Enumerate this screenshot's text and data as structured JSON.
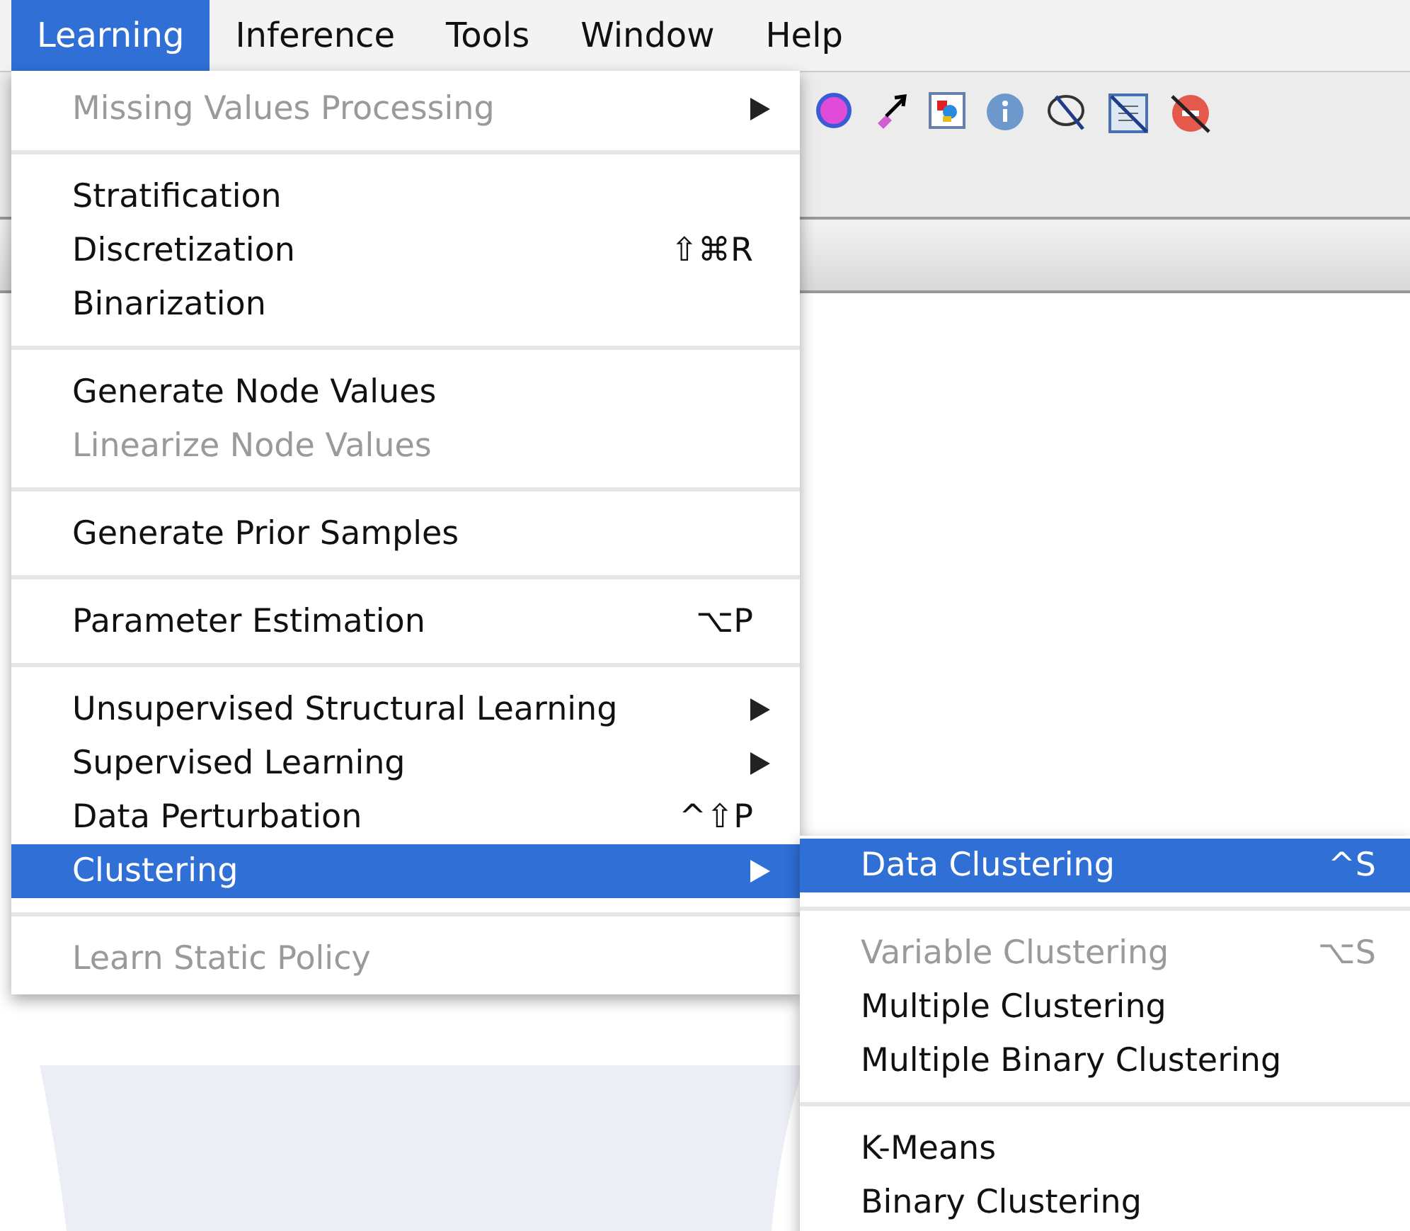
{
  "menubar": [
    {
      "label": "Learning",
      "selected": true
    },
    {
      "label": "Inference",
      "selected": false
    },
    {
      "label": "Tools",
      "selected": false
    },
    {
      "label": "Window",
      "selected": false
    },
    {
      "label": "Help",
      "selected": false
    }
  ],
  "menu": [
    [
      {
        "label": "Missing Values Processing",
        "submenu": true,
        "disabled": true,
        "selected": false
      }
    ],
    [
      {
        "label": "Stratification",
        "submenu": false,
        "disabled": false,
        "selected": false
      },
      {
        "label": "Discretization",
        "shortcut": "⇧⌘R",
        "submenu": false,
        "disabled": false,
        "selected": false
      },
      {
        "label": "Binarization",
        "submenu": false,
        "disabled": false,
        "selected": false
      }
    ],
    [
      {
        "label": "Generate Node Values",
        "submenu": false,
        "disabled": false,
        "selected": false
      },
      {
        "label": "Linearize Node Values",
        "submenu": false,
        "disabled": true,
        "selected": false
      }
    ],
    [
      {
        "label": "Generate Prior Samples",
        "submenu": false,
        "disabled": false,
        "selected": false
      }
    ],
    [
      {
        "label": "Parameter Estimation",
        "shortcut": "⌥P",
        "submenu": false,
        "disabled": false,
        "selected": false
      }
    ],
    [
      {
        "label": "Unsupervised Structural Learning",
        "submenu": true,
        "disabled": false,
        "selected": false
      },
      {
        "label": "Supervised Learning",
        "submenu": true,
        "disabled": false,
        "selected": false
      },
      {
        "label": "Data Perturbation",
        "shortcut": "^⇧P",
        "submenu": false,
        "disabled": false,
        "selected": false
      },
      {
        "label": "Clustering",
        "submenu": true,
        "disabled": false,
        "selected": true
      }
    ],
    [
      {
        "label": "Learn Static Policy",
        "submenu": false,
        "disabled": true,
        "selected": false
      }
    ]
  ],
  "submenu": [
    [
      {
        "label": "Data Clustering",
        "shortcut": "^S",
        "disabled": false,
        "selected": true
      }
    ],
    [
      {
        "label": "Variable Clustering",
        "shortcut": "⌥S",
        "disabled": true,
        "selected": false
      },
      {
        "label": "Multiple Clustering",
        "disabled": false,
        "selected": false
      },
      {
        "label": "Multiple Binary Clustering",
        "disabled": false,
        "selected": false
      }
    ],
    [
      {
        "label": "K-Means",
        "disabled": false,
        "selected": false
      },
      {
        "label": "Binary Clustering",
        "disabled": false,
        "selected": false
      }
    ]
  ]
}
